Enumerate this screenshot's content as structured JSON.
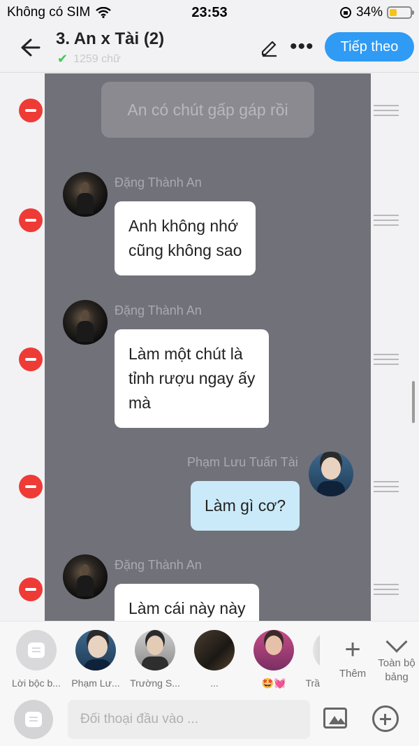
{
  "status_bar": {
    "carrier": "Không có SIM",
    "time": "23:53",
    "battery": "34%",
    "battery_level": 0.34
  },
  "header": {
    "title": "3. An x Tài (2)",
    "subtitle": "1259 chữ",
    "next_label": "Tiếp theo"
  },
  "messages": [
    {
      "type": "narration",
      "text": "An có chút gấp gáp rồi"
    },
    {
      "type": "left",
      "sender": "Đặng Thành An",
      "text": "Anh không nhớ\ncũng không sao"
    },
    {
      "type": "left",
      "sender": "Đặng Thành An",
      "text": "Làm một chút là\ntỉnh rượu ngay ấy\nmà"
    },
    {
      "type": "right",
      "sender": "Phạm Lưu Tuấn Tài",
      "text": "Làm gì cơ?"
    },
    {
      "type": "left",
      "sender": "Đặng Thành An",
      "text": "Làm cái này này"
    }
  ],
  "characters": [
    {
      "label": "Lời bộc b..."
    },
    {
      "label": "Phạm Lư..."
    },
    {
      "label": "Trường S..."
    },
    {
      "label": "..."
    },
    {
      "label": "🤩💓"
    },
    {
      "label": "Trầ"
    }
  ],
  "more_label": "Thêm",
  "whole_table_label": "Toàn bộ bảng",
  "input": {
    "placeholder": "Đối thoại đầu vào ..."
  },
  "colors": {
    "accent": "#2f9bf5",
    "delete": "#ee3b36",
    "chat_background": "#71717a",
    "my_bubble": "#cbeaf9"
  },
  "icons": [
    "wifi-icon",
    "back-arrow-icon",
    "pencil-icon",
    "more-icon",
    "delete-icon",
    "drag-handle-icon",
    "chat-icon",
    "image-icon",
    "plus-circle-icon",
    "chevron-down-icon"
  ]
}
